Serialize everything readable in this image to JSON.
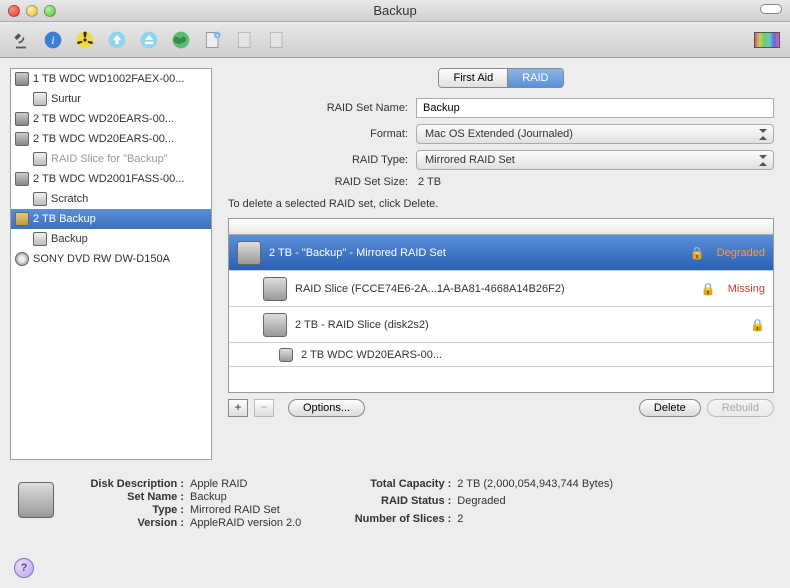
{
  "window_title": "Backup",
  "toolbar_icons": [
    "microscope",
    "info",
    "radiation",
    "up-arrow",
    "down-arrow",
    "globe",
    "new-doc",
    "doc-copy",
    "doc-export"
  ],
  "sidebar": {
    "items": [
      {
        "label": "1 TB WDC WD1002FAEX-00...",
        "children": [
          {
            "label": "Surtur"
          }
        ]
      },
      {
        "label": "2 TB WDC WD20EARS-00...",
        "children": []
      },
      {
        "label": "2 TB WDC WD20EARS-00...",
        "children": [
          {
            "label": "RAID Slice for \"Backup\"",
            "dim": true
          }
        ]
      },
      {
        "label": "2 TB WDC WD2001FASS-00...",
        "children": [
          {
            "label": "Scratch"
          }
        ]
      },
      {
        "label": "2 TB Backup",
        "raid": true,
        "selected": true,
        "children": [
          {
            "label": "Backup"
          }
        ]
      },
      {
        "label": "SONY DVD RW DW-D150A",
        "dvd": true,
        "children": []
      }
    ]
  },
  "tabs": {
    "first_aid": "First Aid",
    "raid": "RAID"
  },
  "form": {
    "set_name_label": "RAID Set Name:",
    "set_name_value": "Backup",
    "format_label": "Format:",
    "format_value": "Mac OS Extended (Journaled)",
    "type_label": "RAID Type:",
    "type_value": "Mirrored RAID Set",
    "size_label": "RAID Set Size:",
    "size_value": "2 TB"
  },
  "instruction": "To delete a selected RAID set, click Delete.",
  "slices": [
    {
      "indent": 0,
      "label": "2 TB - \"Backup\" - Mirrored RAID Set",
      "lock": true,
      "status": "Degraded",
      "status_class": "orange",
      "selected": true
    },
    {
      "indent": 1,
      "label": "RAID Slice (FCCE74E6-2A...1A-BA81-4668A14B26F2)",
      "lock": true,
      "status": "Missing",
      "status_class": "red"
    },
    {
      "indent": 1,
      "label": "2 TB - RAID Slice (disk2s2)",
      "lock": true
    },
    {
      "indent": 2,
      "label": "2 TB WDC WD20EARS-00...",
      "small": true
    }
  ],
  "actions": {
    "add": "+",
    "remove": "−",
    "options": "Options...",
    "delete": "Delete",
    "rebuild": "Rebuild"
  },
  "footer": {
    "left": [
      {
        "k": "Disk Description :",
        "v": "Apple RAID"
      },
      {
        "k": "Set Name :",
        "v": "Backup"
      },
      {
        "k": "Type :",
        "v": "Mirrored RAID Set"
      },
      {
        "k": "Version :",
        "v": "AppleRAID version 2.0"
      }
    ],
    "right": [
      {
        "k": "Total Capacity :",
        "v": "2 TB (2,000,054,943,744 Bytes)"
      },
      {
        "k": "RAID Status :",
        "v": "Degraded"
      },
      {
        "k": "Number of Slices :",
        "v": "2"
      }
    ]
  }
}
